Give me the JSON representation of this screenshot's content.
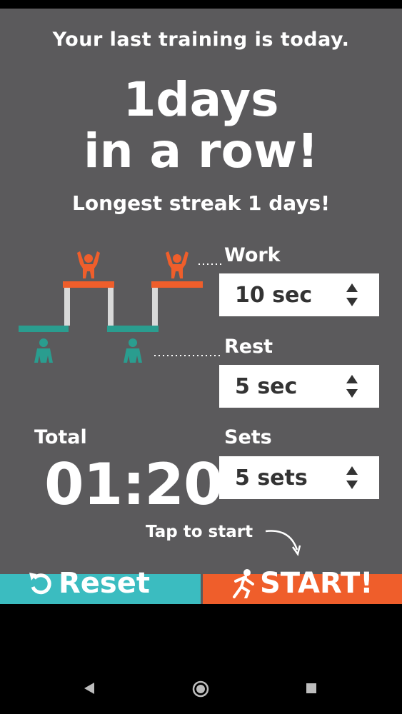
{
  "header": {
    "last_training": "Your last training is today.",
    "streak_line1": "1days",
    "streak_line2": "in a row!",
    "longest": "Longest streak 1 days!"
  },
  "settings": {
    "work_label": "Work",
    "work_value": "10 sec",
    "rest_label": "Rest",
    "rest_value": "5 sec",
    "sets_label": "Sets",
    "sets_value": "5 sets"
  },
  "total": {
    "label": "Total",
    "time": "01:20"
  },
  "hint": "Tap to start",
  "buttons": {
    "reset": "Reset",
    "start": "START!"
  },
  "colors": {
    "background": "#5b5a5c",
    "work": "#ef5e2b",
    "rest": "#2a9d8f",
    "reset": "#3bbcc0",
    "start": "#ef5e2b"
  },
  "icons": {
    "reset": "reset-icon",
    "start": "runner-icon",
    "work": "flexing-person-icon",
    "rest": "resting-person-icon"
  }
}
